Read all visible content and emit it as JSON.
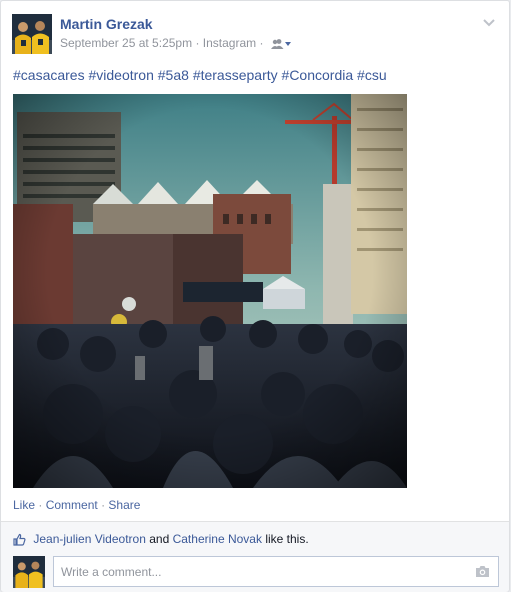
{
  "post": {
    "author": "Martin Grezak",
    "timestamp": "September 25 at 5:25pm",
    "separator": "·",
    "source": "Instagram",
    "audience_icon": "friends-icon",
    "caption_tags": [
      "#casacares",
      "#videotron",
      "#5a8",
      "#terasseparty",
      "#Concordia",
      "#csu"
    ]
  },
  "actions": {
    "like": "Like",
    "comment": "Comment",
    "share": "Share",
    "sep": "·"
  },
  "likes": {
    "icon": "thumbs-up-icon",
    "name1": "Jean-julien Videotron",
    "and": "and",
    "name2": "Catherine Novak",
    "suffix": "like this."
  },
  "comment_box": {
    "placeholder": "Write a comment...",
    "camera_icon": "camera-icon"
  },
  "colors": {
    "link": "#3b5998",
    "muted": "#90949c",
    "bar_bg": "#f6f7f9"
  }
}
